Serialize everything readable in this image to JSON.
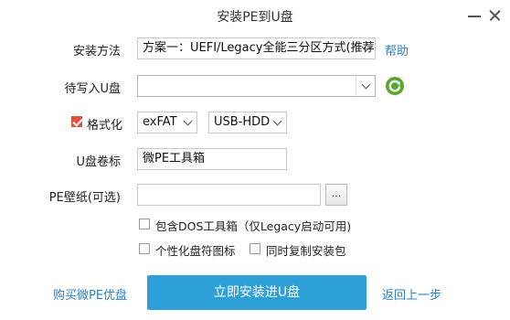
{
  "window": {
    "title": "安装PE到U盘"
  },
  "form": {
    "install_method": {
      "label": "安装方法",
      "value": "方案一：UEFI/Legacy全能三分区方式(推荐)",
      "help": "帮助"
    },
    "target_disk": {
      "label": "待写入U盘",
      "value": ""
    },
    "format": {
      "label": "格式化",
      "checked": true,
      "filesystem": "exFAT",
      "boot_mode": "USB-HDD"
    },
    "volume_label": {
      "label": "U盘卷标",
      "value": "微PE工具箱"
    },
    "wallpaper": {
      "label": "PE壁纸(可选)",
      "value": "",
      "browse": "..."
    },
    "options": [
      {
        "label": "包含DOS工具箱（仅Legacy启动可用)",
        "checked": false
      },
      {
        "label": "个性化盘符图标",
        "checked": false
      },
      {
        "label": "同时复制安装包",
        "checked": false
      }
    ]
  },
  "footer": {
    "buy_link": "购买微PE优盘",
    "install_button": "立即安装进U盘",
    "back_link": "返回上一步"
  },
  "colors": {
    "accent": "#2ea0d8",
    "link": "#2a82c8",
    "checkbox": "#e0533d",
    "refresh": "#5aa82a"
  }
}
